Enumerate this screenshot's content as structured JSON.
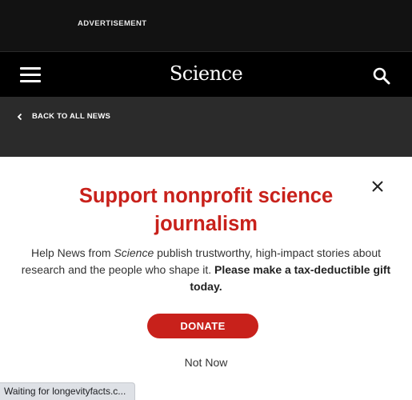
{
  "ad_bar": {
    "label": "ADVERTISEMENT"
  },
  "nav": {
    "logo": "Science",
    "menu_icon": "hamburger-menu-icon",
    "search_icon": "search-icon"
  },
  "sub_nav": {
    "back_label": "BACK TO ALL NEWS",
    "back_icon": "chevron-left-icon"
  },
  "modal": {
    "headline": "Support nonprofit science journalism",
    "body_part1": "Help News from ",
    "body_italic": "Science",
    "body_part2": " publish trustworthy, high-impact stories about research and the people who shape it. ",
    "body_bold": "Please make a tax-deductible gift today.",
    "donate_label": "DONATE",
    "not_now_label": "Not Now",
    "close_icon": "close-icon",
    "accent_color": "#c8211b"
  },
  "status_bar": {
    "text": "Waiting for longevityfacts.c..."
  }
}
